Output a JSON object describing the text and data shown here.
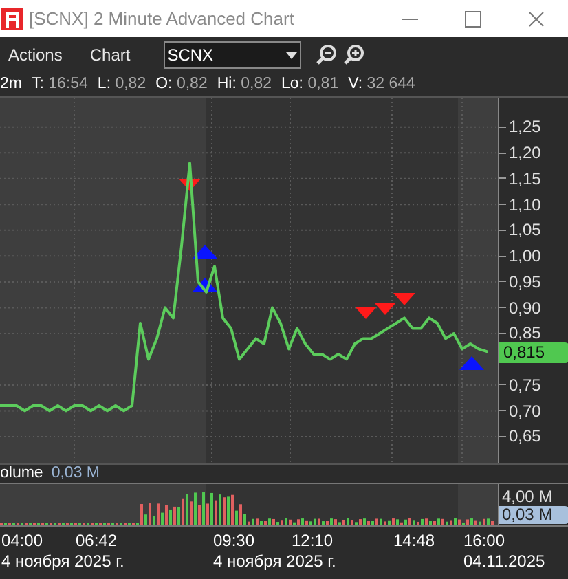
{
  "window": {
    "title": "[SCNX] 2 Minute Advanced Chart"
  },
  "menu": [
    "Actions",
    "Chart"
  ],
  "symbol_select": {
    "value": "SCNX"
  },
  "interval": "2m",
  "quote": [
    {
      "label": "T:",
      "value": "16:54"
    },
    {
      "label": "L:",
      "value": "0,82"
    },
    {
      "label": "O:",
      "value": "0,82"
    },
    {
      "label": "Hi:",
      "value": "0,82"
    },
    {
      "label": "Lo:",
      "value": "0,81"
    },
    {
      "label": "V:",
      "value": "32 644"
    }
  ],
  "price_chart": {
    "last_price": "0,815",
    "chart_data": {
      "type": "line",
      "grid": true,
      "ylim": [
        0.598,
        1.307
      ],
      "yticks": [
        {
          "value": 1.25,
          "label": "1,25"
        },
        {
          "value": 1.2,
          "label": "1,20"
        },
        {
          "value": 1.15,
          "label": "1,15"
        },
        {
          "value": 1.1,
          "label": "1,10"
        },
        {
          "value": 1.05,
          "label": "1,05"
        },
        {
          "value": 1.0,
          "label": "1,00"
        },
        {
          "value": 0.95,
          "label": "0,95"
        },
        {
          "value": 0.9,
          "label": "0,90"
        },
        {
          "value": 0.85,
          "label": "0,85"
        },
        {
          "value": 0.75,
          "label": "0,75"
        },
        {
          "value": 0.7,
          "label": "0,70"
        },
        {
          "value": 0.65,
          "label": "0,65"
        }
      ],
      "series": [
        {
          "color": "#5ccc5c",
          "values": [
            0.71,
            0.71,
            0.71,
            0.7,
            0.71,
            0.71,
            0.7,
            0.71,
            0.7,
            0.71,
            0.71,
            0.7,
            0.71,
            0.7,
            0.71,
            0.7,
            0.71,
            0.87,
            0.8,
            0.84,
            0.9,
            0.88,
            1.02,
            1.18,
            0.95,
            0.93,
            0.98,
            0.88,
            0.86,
            0.8,
            0.82,
            0.84,
            0.83,
            0.9,
            0.87,
            0.82,
            0.86,
            0.83,
            0.81,
            0.81,
            0.8,
            0.81,
            0.8,
            0.83,
            0.84,
            0.84,
            0.85,
            0.86,
            0.87,
            0.88,
            0.86,
            0.86,
            0.88,
            0.87,
            0.84,
            0.85,
            0.82,
            0.83,
            0.82,
            0.815
          ]
        }
      ]
    },
    "signals": [
      {
        "kind": "sell"
      },
      {
        "kind": "buy"
      },
      {
        "kind": "buy"
      },
      {
        "kind": "sell"
      },
      {
        "kind": "sell"
      },
      {
        "kind": "sell"
      },
      {
        "kind": "buy"
      }
    ]
  },
  "volume": {
    "title": "olume",
    "value": "0,03 M",
    "tick": "4,00 M",
    "current": "0,03 M"
  },
  "time_axis": [
    {
      "time": "04:00",
      "date": "4 ноября 2025 г."
    },
    {
      "time": "06:42"
    },
    {
      "time": "09:30",
      "date": "4 ноября 2025 г."
    },
    {
      "time": "12:10"
    },
    {
      "time": "14:48"
    },
    {
      "time": "16:00",
      "date": "04.11.2025"
    }
  ]
}
